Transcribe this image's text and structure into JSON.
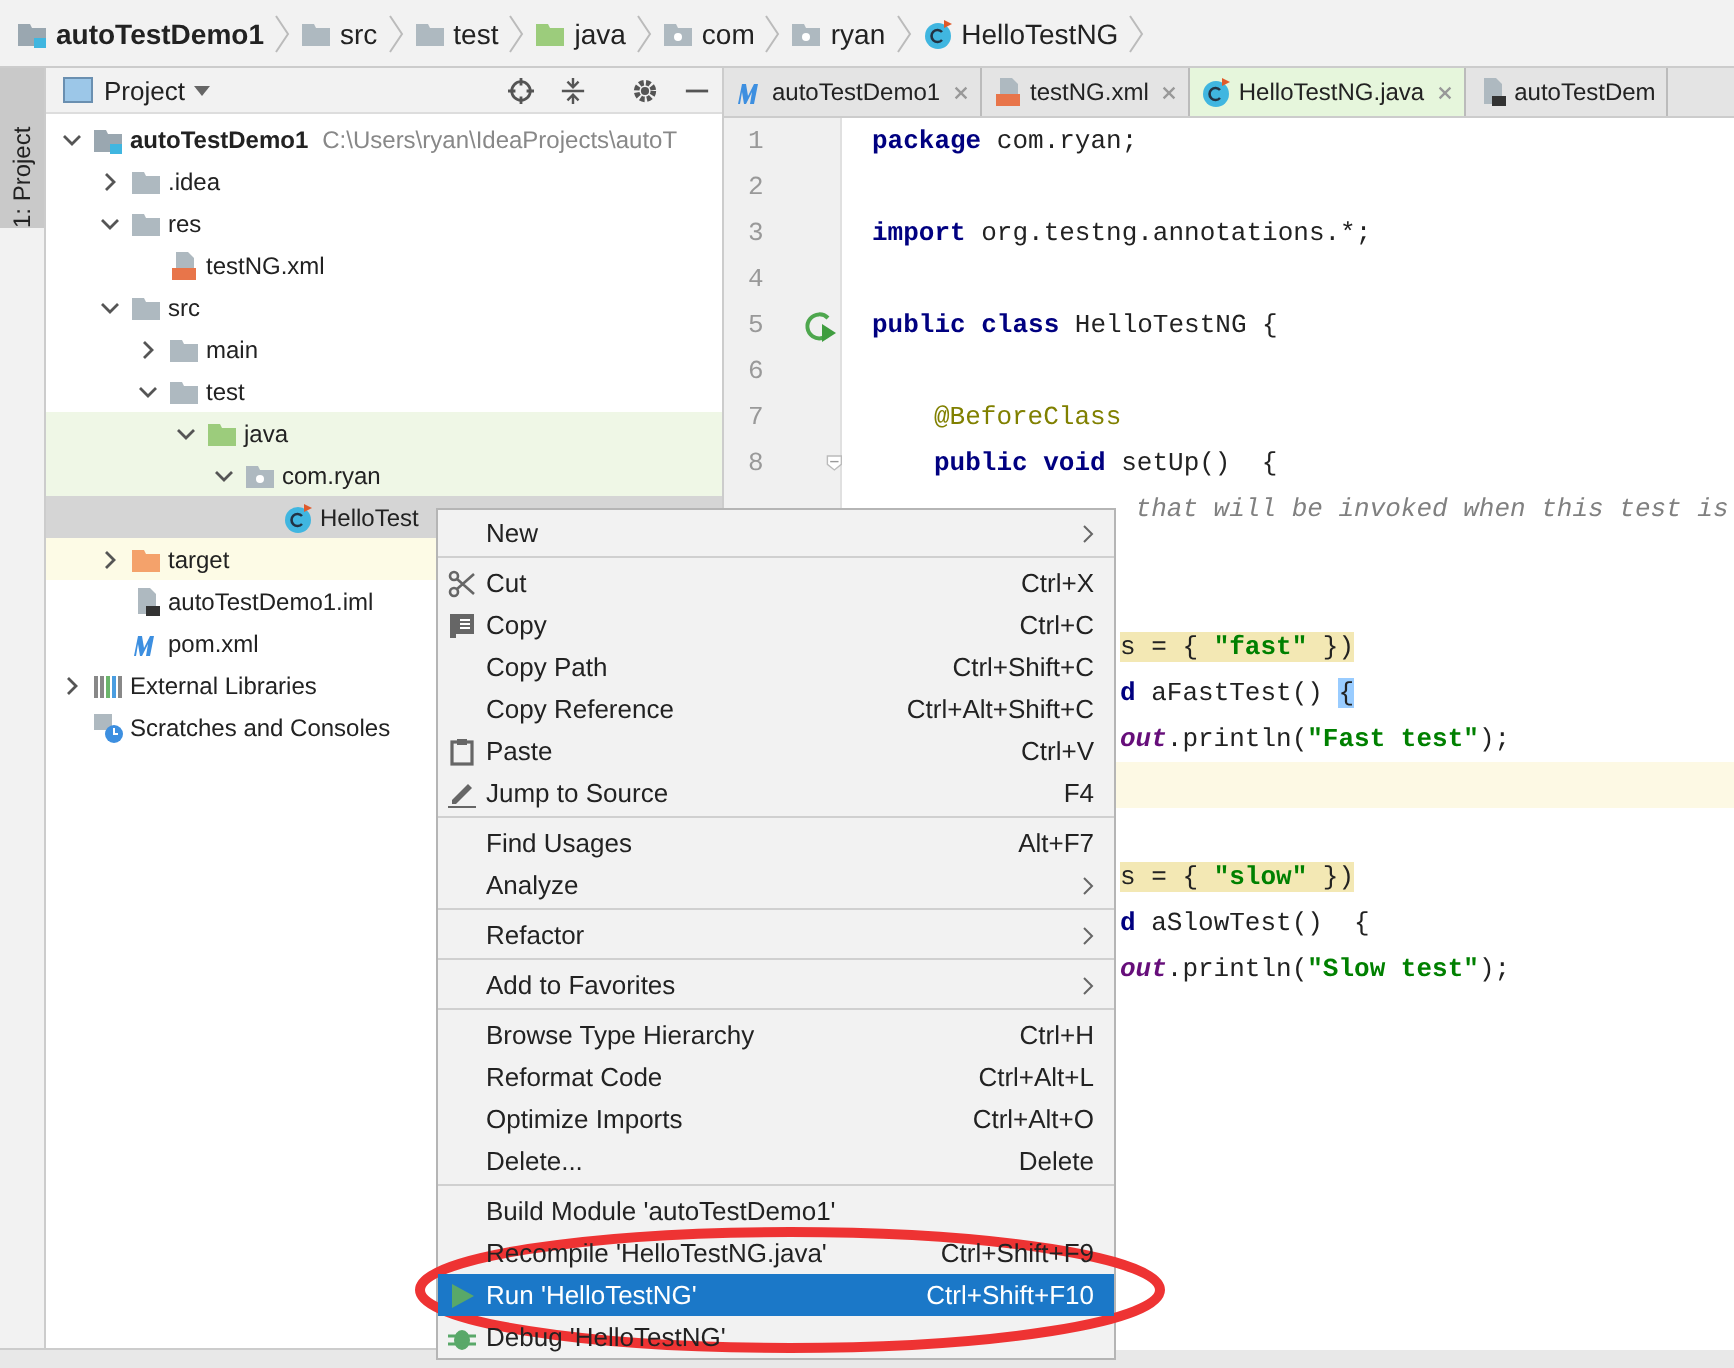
{
  "breadcrumbs": [
    {
      "label": "autoTestDemo1",
      "kind": "module"
    },
    {
      "label": "src",
      "kind": "folder"
    },
    {
      "label": "test",
      "kind": "folder"
    },
    {
      "label": "java",
      "kind": "folder-test"
    },
    {
      "label": "com",
      "kind": "package"
    },
    {
      "label": "ryan",
      "kind": "package"
    },
    {
      "label": "HelloTestNG",
      "kind": "class"
    }
  ],
  "tool_strip": {
    "label": "1: Project"
  },
  "project_panel": {
    "title": "Project",
    "tree": [
      {
        "label": "autoTestDemo1",
        "path": "C:\\Users\\ryan\\IdeaProjects\\autoT",
        "kind": "module",
        "expanded": true,
        "selected": false,
        "children": [
          {
            "label": ".idea",
            "kind": "folder",
            "expanded": false,
            "selected": false
          },
          {
            "label": "res",
            "kind": "folder",
            "expanded": true,
            "selected": false,
            "children": [
              {
                "label": "testNG.xml",
                "kind": "xml",
                "selected": false
              }
            ]
          },
          {
            "label": "src",
            "kind": "folder",
            "expanded": true,
            "selected": false,
            "children": [
              {
                "label": "main",
                "kind": "folder",
                "expanded": false,
                "selected": false
              },
              {
                "label": "test",
                "kind": "folder",
                "expanded": true,
                "selected": false,
                "children": [
                  {
                    "label": "java",
                    "kind": "folder-test",
                    "expanded": true,
                    "selected": false,
                    "children": [
                      {
                        "label": "com.ryan",
                        "kind": "package",
                        "expanded": true,
                        "selected": false,
                        "children": [
                          {
                            "label": "HelloTest",
                            "kind": "class",
                            "selected": true
                          }
                        ]
                      }
                    ]
                  }
                ]
              }
            ]
          },
          {
            "label": "target",
            "kind": "folder-excluded",
            "expanded": false,
            "selected": false
          },
          {
            "label": "autoTestDemo1.iml",
            "kind": "iml",
            "selected": false
          },
          {
            "label": "pom.xml",
            "kind": "maven",
            "selected": false
          }
        ]
      },
      {
        "label": "External Libraries",
        "kind": "libraries",
        "expanded": false,
        "selected": false
      },
      {
        "label": "Scratches and Consoles",
        "kind": "scratches",
        "selected": false
      }
    ]
  },
  "editor": {
    "tabs": [
      {
        "label": "autoTestDemo1",
        "kind": "maven",
        "selected": false
      },
      {
        "label": "testNG.xml",
        "kind": "xml",
        "selected": false
      },
      {
        "label": "HelloTestNG.java",
        "kind": "class",
        "selected": true
      },
      {
        "label": "autoTestDem",
        "kind": "iml",
        "selected": false
      }
    ],
    "lines": [
      {
        "number": "1",
        "kind": "full",
        "current": false,
        "highlighted": false,
        "segments": [
          {
            "t": "package",
            "kind": "keyword"
          },
          {
            "t": " com.ryan;",
            "kind": "plain"
          }
        ]
      },
      {
        "number": "2",
        "kind": "full",
        "current": false
      },
      {
        "number": "3",
        "kind": "full",
        "current": false,
        "highlighted": false,
        "segments": [
          {
            "t": "import",
            "kind": "keyword"
          },
          {
            "t": " org.testng.annotations.*;",
            "kind": "plain"
          }
        ]
      },
      {
        "number": "4",
        "kind": "full",
        "current": false
      },
      {
        "number": "5",
        "kind": "full",
        "current": false,
        "highlighted": false,
        "runnable": true,
        "segments": [
          {
            "t": "public class",
            "kind": "keyword"
          },
          {
            "t": " HelloTestNG {",
            "kind": "plain"
          }
        ]
      },
      {
        "number": "6",
        "kind": "full",
        "current": false
      },
      {
        "number": "7",
        "kind": "indented",
        "current": false,
        "highlighted": false,
        "segments": [
          {
            "t": "@BeforeClass",
            "kind": "annotation"
          }
        ]
      },
      {
        "number": "8",
        "kind": "indented",
        "current": false,
        "highlighted": false,
        "foldable": true,
        "segments": [
          {
            "t": "public void",
            "kind": "keyword"
          },
          {
            "t": " setUp()  {",
            "kind": "plain"
          }
        ]
      },
      {
        "kind": "partial",
        "current": false,
        "highlighted": false,
        "segments": [
          {
            "t": " that will be invoked when this test is",
            "kind": "comment"
          }
        ]
      },
      {
        "kind": "partial",
        "current": false
      },
      {
        "kind": "partial",
        "current": false
      },
      {
        "kind": "partial",
        "current": false,
        "highlighted": true,
        "segments": [
          {
            "t": "s = { ",
            "kind": "plain"
          },
          {
            "t": "\"fast\"",
            "kind": "string"
          },
          {
            "t": " })",
            "kind": "plain"
          }
        ]
      },
      {
        "kind": "partial",
        "current": false,
        "highlighted": false,
        "segments": [
          {
            "t": "d",
            "kind": "keyword"
          },
          {
            "t": " aFastTest() ",
            "kind": "plain"
          },
          {
            "t": "{",
            "kind": "brace-match"
          }
        ]
      },
      {
        "kind": "partial",
        "current": false,
        "highlighted": false,
        "segments": [
          {
            "t": "out",
            "kind": "field"
          },
          {
            "t": ".println(",
            "kind": "plain"
          },
          {
            "t": "\"Fast test\"",
            "kind": "string"
          },
          {
            "t": ");",
            "kind": "plain"
          }
        ]
      },
      {
        "kind": "partial",
        "current": true
      },
      {
        "kind": "partial",
        "current": false
      },
      {
        "kind": "partial",
        "current": false,
        "highlighted": true,
        "segments": [
          {
            "t": "s = { ",
            "kind": "plain"
          },
          {
            "t": "\"slow\"",
            "kind": "string"
          },
          {
            "t": " })",
            "kind": "plain"
          }
        ]
      },
      {
        "kind": "partial",
        "current": false,
        "highlighted": false,
        "segments": [
          {
            "t": "d",
            "kind": "keyword"
          },
          {
            "t": " aSlowTest()  {",
            "kind": "plain"
          }
        ]
      },
      {
        "kind": "partial",
        "current": false,
        "highlighted": false,
        "segments": [
          {
            "t": "out",
            "kind": "field"
          },
          {
            "t": ".println(",
            "kind": "plain"
          },
          {
            "t": "\"Slow test\"",
            "kind": "string"
          },
          {
            "t": ");",
            "kind": "plain"
          }
        ]
      }
    ]
  },
  "context_menu": {
    "items": [
      {
        "kind": "item",
        "label": "New",
        "submenu": true,
        "selected": false
      },
      {
        "kind": "separator"
      },
      {
        "kind": "cut",
        "label": "Cut",
        "shortcut": "Ctrl+X",
        "selected": false
      },
      {
        "kind": "copy",
        "label": "Copy",
        "shortcut": "Ctrl+C",
        "selected": false
      },
      {
        "kind": "item",
        "label": "Copy Path",
        "shortcut": "Ctrl+Shift+C",
        "selected": false
      },
      {
        "kind": "item",
        "label": "Copy Reference",
        "shortcut": "Ctrl+Alt+Shift+C",
        "selected": false
      },
      {
        "kind": "paste",
        "label": "Paste",
        "shortcut": "Ctrl+V",
        "selected": false
      },
      {
        "kind": "jump",
        "label": "Jump to Source",
        "shortcut": "F4",
        "selected": false
      },
      {
        "kind": "separator"
      },
      {
        "kind": "item",
        "label": "Find Usages",
        "shortcut": "Alt+F7",
        "selected": false
      },
      {
        "kind": "item",
        "label": "Analyze",
        "submenu": true,
        "selected": false
      },
      {
        "kind": "separator"
      },
      {
        "kind": "item",
        "label": "Refactor",
        "submenu": true,
        "selected": false
      },
      {
        "kind": "separator"
      },
      {
        "kind": "item",
        "label": "Add to Favorites",
        "submenu": true,
        "selected": false
      },
      {
        "kind": "separator"
      },
      {
        "kind": "item",
        "label": "Browse Type Hierarchy",
        "shortcut": "Ctrl+H",
        "selected": false
      },
      {
        "kind": "item",
        "label": "Reformat Code",
        "shortcut": "Ctrl+Alt+L",
        "selected": false
      },
      {
        "kind": "item",
        "label": "Optimize Imports",
        "shortcut": "Ctrl+Alt+O",
        "selected": false
      },
      {
        "kind": "item",
        "label": "Delete...",
        "shortcut": "Delete",
        "selected": false
      },
      {
        "kind": "separator"
      },
      {
        "kind": "item",
        "label": "Build Module 'autoTestDemo1'",
        "selected": false
      },
      {
        "kind": "item",
        "label": "Recompile 'HelloTestNG.java'",
        "shortcut": "Ctrl+Shift+F9",
        "selected": false
      },
      {
        "kind": "run",
        "label": "Run 'HelloTestNG'",
        "shortcut": "Ctrl+Shift+F10",
        "selected": true
      },
      {
        "kind": "debug",
        "label": "Debug 'HelloTestNG'",
        "selected": false
      }
    ]
  }
}
